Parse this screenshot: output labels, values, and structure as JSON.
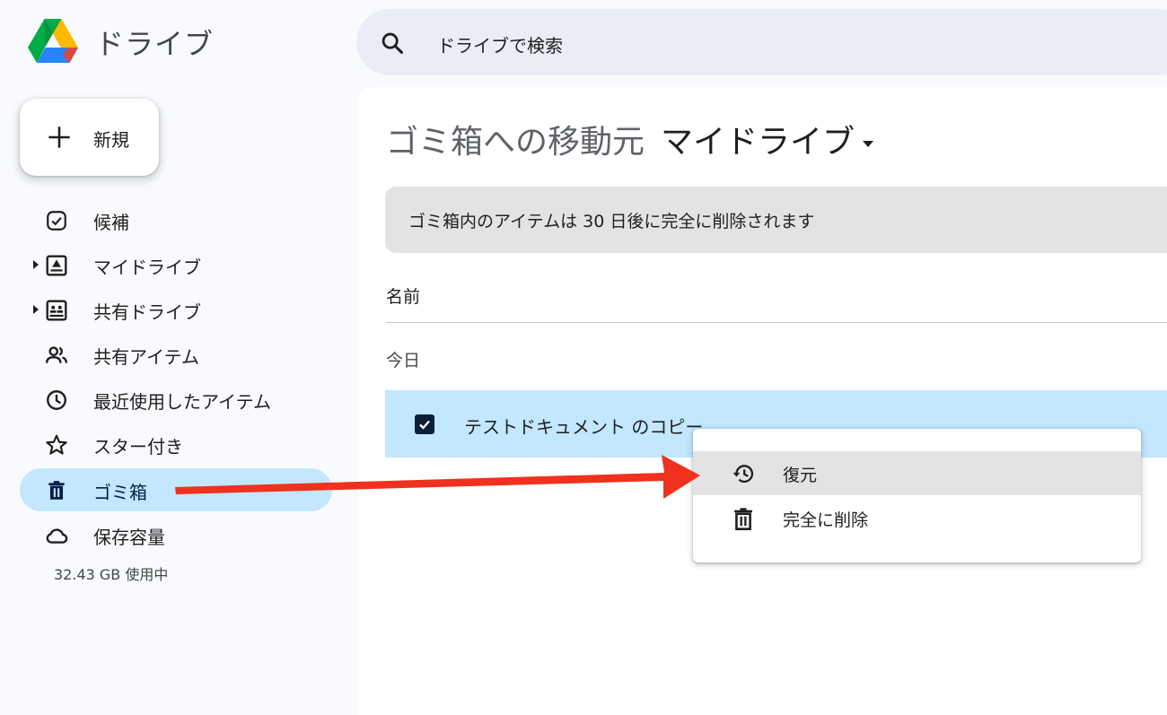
{
  "app": {
    "title": "ドライブ"
  },
  "search": {
    "placeholder": "ドライブで検索"
  },
  "new_button": {
    "label": "新規"
  },
  "sidebar": {
    "items": [
      {
        "label": "候補",
        "icon": "suggested-icon",
        "expandable": false,
        "active": false
      },
      {
        "label": "マイドライブ",
        "icon": "my-drive-icon",
        "expandable": true,
        "active": false
      },
      {
        "label": "共有ドライブ",
        "icon": "shared-drives-icon",
        "expandable": true,
        "active": false
      },
      {
        "label": "共有アイテム",
        "icon": "people-icon",
        "expandable": false,
        "active": false
      },
      {
        "label": "最近使用したアイテム",
        "icon": "clock-icon",
        "expandable": false,
        "active": false
      },
      {
        "label": "スター付き",
        "icon": "star-icon",
        "expandable": false,
        "active": false
      },
      {
        "label": "ゴミ箱",
        "icon": "trash-icon",
        "expandable": false,
        "active": true
      },
      {
        "label": "保存容量",
        "icon": "cloud-icon",
        "expandable": false,
        "active": false
      }
    ],
    "storage_usage": "32.43 GB 使用中"
  },
  "main": {
    "heading_prefix": "ゴミ箱への移動元",
    "heading_location": "マイドライブ",
    "banner": "ゴミ箱内のアイテムは 30 日後に完全に削除されます",
    "column_name": "名前",
    "group_label": "今日",
    "files": [
      {
        "name": "テストドキュメント のコピー",
        "selected": true
      }
    ]
  },
  "context_menu": {
    "items": [
      {
        "label": "復元",
        "icon": "restore-icon",
        "highlighted": true
      },
      {
        "label": "完全に削除",
        "icon": "delete-forever-icon",
        "highlighted": false
      }
    ]
  },
  "colors": {
    "active_nav": "#c2e7ff",
    "selected_row": "#c2e7ff",
    "search_bg": "#e9eef6",
    "banner_bg": "#e3e3e3",
    "annotation_arrow": "#f0311d"
  }
}
